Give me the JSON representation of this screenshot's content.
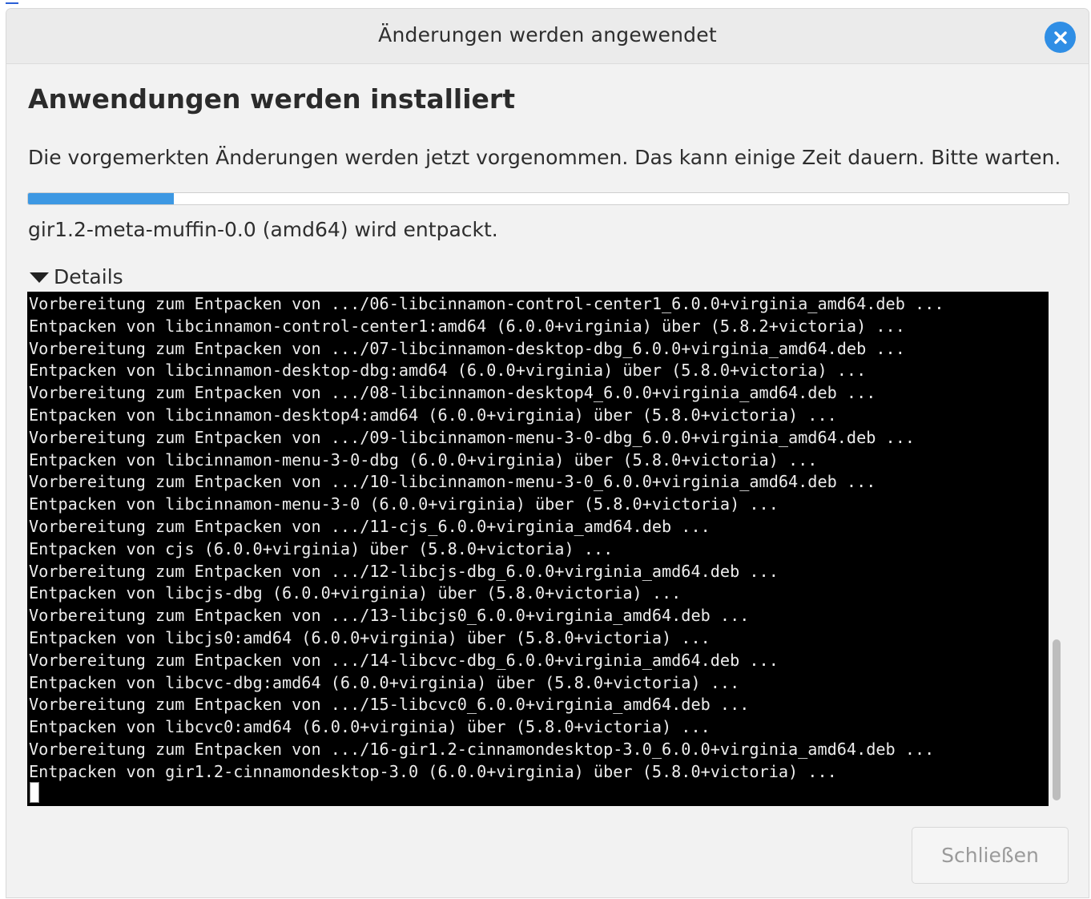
{
  "window": {
    "title": "Änderungen werden angewendet"
  },
  "main": {
    "heading": "Anwendungen werden installiert",
    "description": "Die vorgemerkten Änderungen werden jetzt vorgenommen. Das kann einige Zeit dauern. Bitte warten.",
    "progress_percent": 14,
    "status": "gir1.2-meta-muffin-0.0 (amd64) wird entpackt.",
    "details_label": "Details"
  },
  "terminal": {
    "lines": [
      "Vorbereitung zum Entpacken von .../06-libcinnamon-control-center1_6.0.0+virginia_amd64.deb ...",
      "Entpacken von libcinnamon-control-center1:amd64 (6.0.0+virginia) über (5.8.2+victoria) ...",
      "Vorbereitung zum Entpacken von .../07-libcinnamon-desktop-dbg_6.0.0+virginia_amd64.deb ...",
      "Entpacken von libcinnamon-desktop-dbg:amd64 (6.0.0+virginia) über (5.8.0+victoria) ...",
      "Vorbereitung zum Entpacken von .../08-libcinnamon-desktop4_6.0.0+virginia_amd64.deb ...",
      "Entpacken von libcinnamon-desktop4:amd64 (6.0.0+virginia) über (5.8.0+victoria) ...",
      "Vorbereitung zum Entpacken von .../09-libcinnamon-menu-3-0-dbg_6.0.0+virginia_amd64.deb ...",
      "Entpacken von libcinnamon-menu-3-0-dbg (6.0.0+virginia) über (5.8.0+victoria) ...",
      "Vorbereitung zum Entpacken von .../10-libcinnamon-menu-3-0_6.0.0+virginia_amd64.deb ...",
      "Entpacken von libcinnamon-menu-3-0 (6.0.0+virginia) über (5.8.0+victoria) ...",
      "Vorbereitung zum Entpacken von .../11-cjs_6.0.0+virginia_amd64.deb ...",
      "Entpacken von cjs (6.0.0+virginia) über (5.8.0+victoria) ...",
      "Vorbereitung zum Entpacken von .../12-libcjs-dbg_6.0.0+virginia_amd64.deb ...",
      "Entpacken von libcjs-dbg (6.0.0+virginia) über (5.8.0+victoria) ...",
      "Vorbereitung zum Entpacken von .../13-libcjs0_6.0.0+virginia_amd64.deb ...",
      "Entpacken von libcjs0:amd64 (6.0.0+virginia) über (5.8.0+victoria) ...",
      "Vorbereitung zum Entpacken von .../14-libcvc-dbg_6.0.0+virginia_amd64.deb ...",
      "Entpacken von libcvc-dbg:amd64 (6.0.0+virginia) über (5.8.0+victoria) ...",
      "Vorbereitung zum Entpacken von .../15-libcvc0_6.0.0+virginia_amd64.deb ...",
      "Entpacken von libcvc0:amd64 (6.0.0+virginia) über (5.8.0+victoria) ...",
      "Vorbereitung zum Entpacken von .../16-gir1.2-cinnamondesktop-3.0_6.0.0+virginia_amd64.deb ...",
      "Entpacken von gir1.2-cinnamondesktop-3.0 (6.0.0+virginia) über (5.8.0+victoria) ..."
    ]
  },
  "footer": {
    "close_label": "Schließen"
  },
  "colors": {
    "accent": "#3d98e3",
    "close_icon_bg": "#2f8ee5",
    "terminal_bg": "#000000"
  },
  "icons": {
    "close": "close-icon",
    "expander": "triangle-down-icon"
  }
}
